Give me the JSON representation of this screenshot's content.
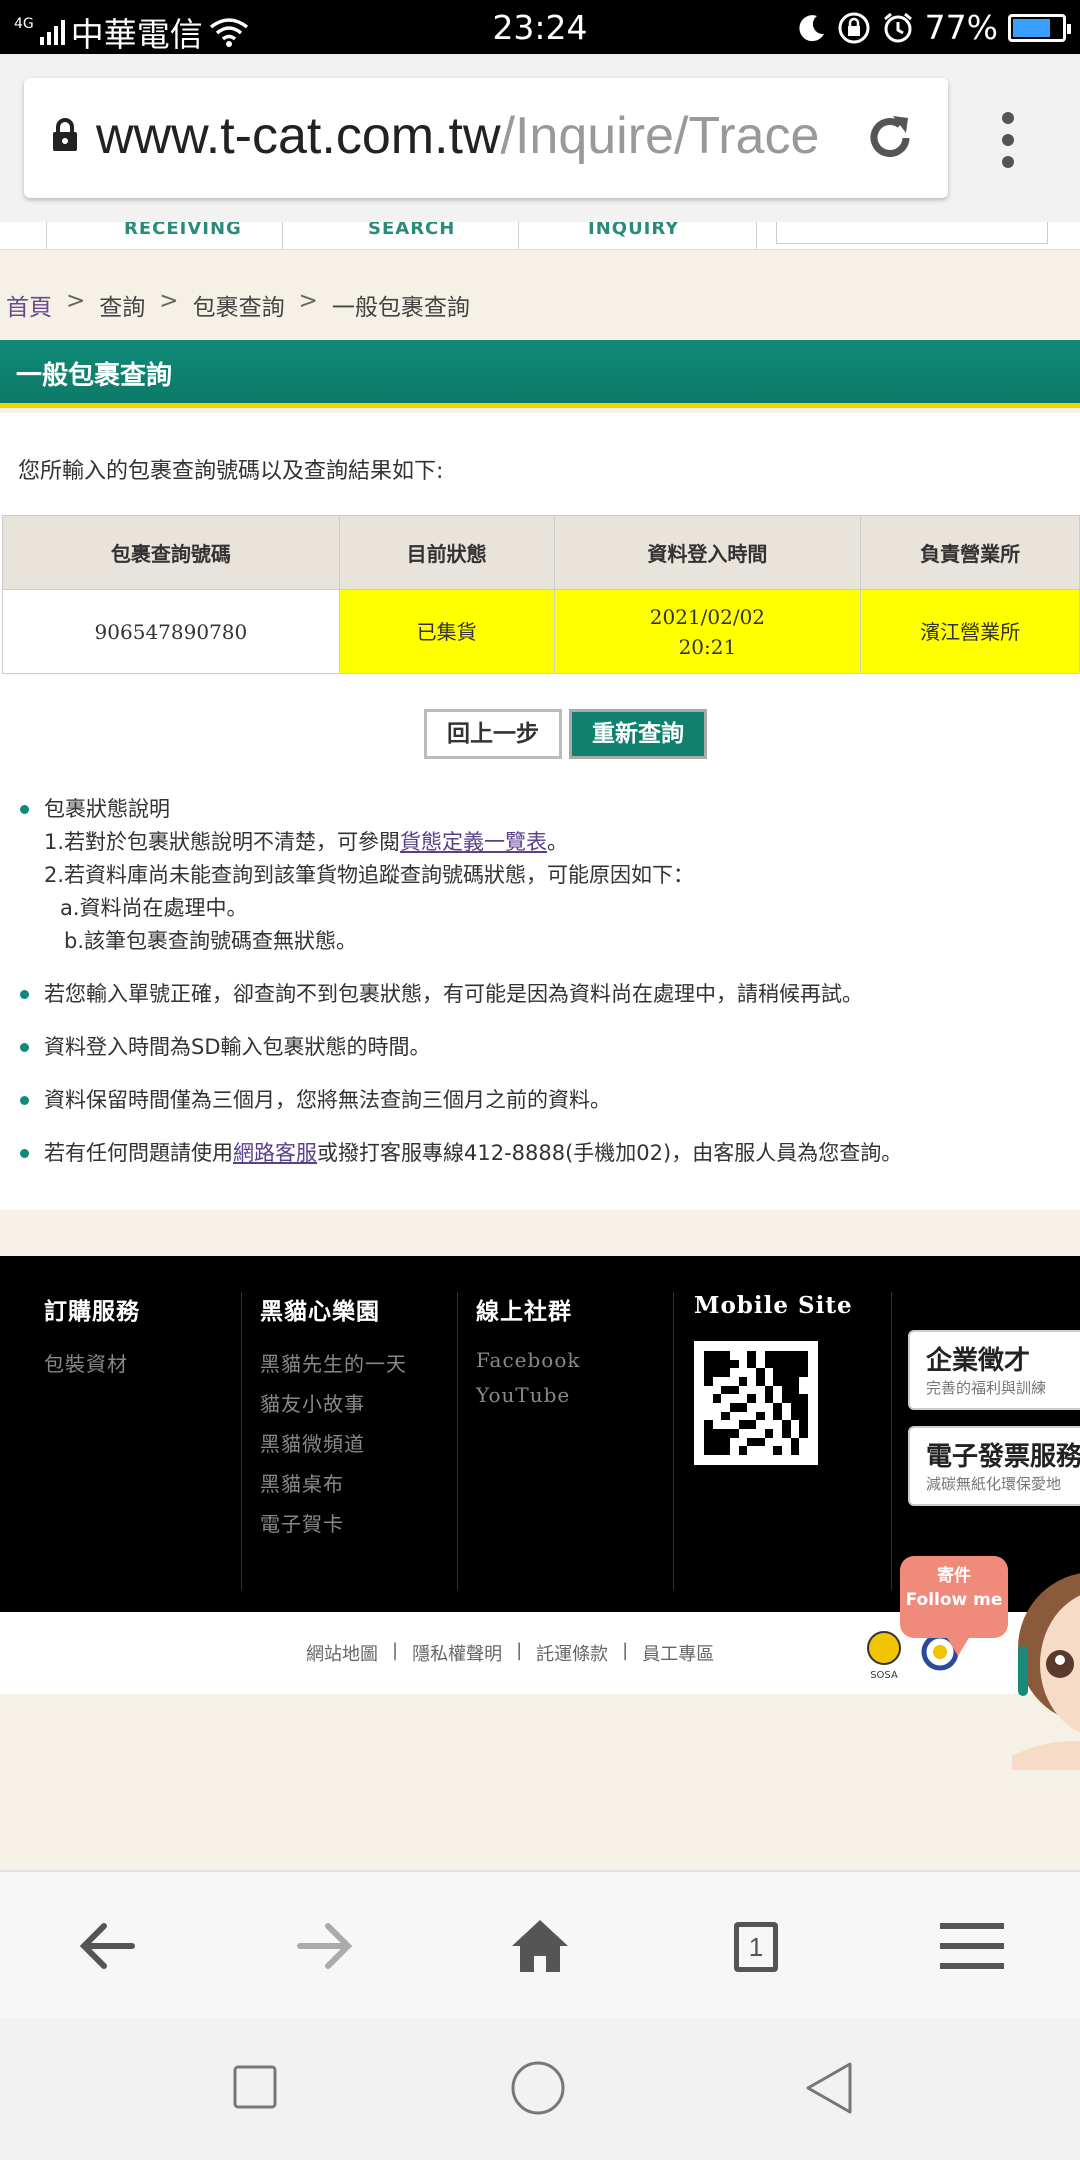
{
  "status_bar": {
    "network": "4G",
    "carrier": "中華電信",
    "time": "23:24",
    "battery": "77%"
  },
  "browser": {
    "url_domain": "www.t-cat.com.tw",
    "url_path": "/Inquire/Trace",
    "tab_count": "1"
  },
  "site_nav": {
    "items": [
      "RECEIVING",
      "SEARCH",
      "INQUIRY"
    ]
  },
  "breadcrumb": {
    "items": [
      "首頁",
      "查詢",
      "包裹查詢",
      "一般包裹查詢"
    ],
    "separator": ">"
  },
  "page": {
    "title": "一般包裹查詢",
    "intro": "您所輸入的包裹查詢號碼以及查詢結果如下:"
  },
  "result_table": {
    "headers": [
      "包裹查詢號碼",
      "目前狀態",
      "資料登入時間",
      "負責營業所"
    ],
    "row": {
      "tracking_no": "906547890780",
      "status": "已集貨",
      "date": "2021/02/02",
      "time": "20:21",
      "office": "濱江營業所"
    }
  },
  "buttons": {
    "back": "回上一步",
    "requery": "重新查詢"
  },
  "notes": {
    "status_title": "包裹狀態說明",
    "status_line1_prefix": "1.若對於包裹狀態說明不清楚，可參閱",
    "status_line1_link": "貨態定義一覽表",
    "status_line1_suffix": "。",
    "status_line2": "2.若資料庫尚未能查詢到該筆貨物追蹤查詢號碼狀態，可能原因如下：",
    "status_line2a": "a.資料尚在處理中。",
    "status_line2b": "b.該筆包裹查詢號碼查無狀態。",
    "note2": "若您輸入單號正確，卻查詢不到包裹狀態，有可能是因為資料尚在處理中，請稍候再試。",
    "note3": "資料登入時間為SD輸入包裹狀態的時間。",
    "note4": "資料保留時間僅為三個月，您將無法查詢三個月之前的資料。",
    "note5_prefix": "若有任何問題請使用",
    "note5_link": "網路客服",
    "note5_suffix": "或撥打客服專線412-8888(手機加02)，由客服人員為您查詢。"
  },
  "footer": {
    "col1_title": "訂購服務",
    "col1_links": [
      "包裝資材"
    ],
    "col2_title": "黑貓心樂園",
    "col2_links": [
      "黑貓先生的一天",
      "貓友小故事",
      "黑貓微頻道",
      "黑貓桌布",
      "電子賀卡"
    ],
    "col3_title": "線上社群",
    "col3_links": [
      "Facebook",
      "YouTube"
    ],
    "col4_title": "Mobile Site",
    "promo1_big": "企業徵才",
    "promo1_small": "完善的福利與訓練",
    "promo2_big": "電子發票服務",
    "promo2_small": "減碳無紙化環保愛地",
    "bottom_links": [
      "網站地圖",
      "隱私權聲明",
      "託運條款",
      "員工專區"
    ],
    "follow_line1": "寄件",
    "follow_line2": "Follow me",
    "logo_text": "SOSA"
  },
  "colors": {
    "brand_green": "#0e8a7a",
    "highlight_yellow": "#ffff00",
    "accent_yellow": "#f1d400"
  }
}
